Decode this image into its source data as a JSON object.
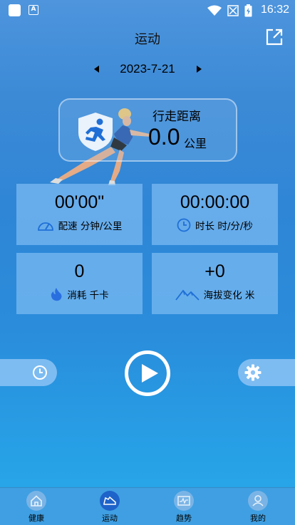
{
  "status_bar": {
    "time": "16:32"
  },
  "header": {
    "title": "运动"
  },
  "date_nav": {
    "date": "2023-7-21"
  },
  "distance": {
    "label": "行走距离",
    "value": "0.0",
    "unit": "公里"
  },
  "stats": [
    {
      "value": "00'00\"",
      "label": "配速 分钟/公里",
      "icon": "speedometer-icon"
    },
    {
      "value": "00:00:00",
      "label": "时长 时/分/秒",
      "icon": "clock-icon"
    },
    {
      "value": "0",
      "label": "消耗 千卡",
      "icon": "flame-icon"
    },
    {
      "value": "+0",
      "label": "海拔变化 米",
      "icon": "mountain-icon"
    }
  ],
  "tabs": [
    {
      "label": "健康",
      "icon": "home-icon"
    },
    {
      "label": "运动",
      "icon": "shoe-icon"
    },
    {
      "label": "趋势",
      "icon": "trend-icon"
    },
    {
      "label": "我的",
      "icon": "person-icon"
    }
  ],
  "colors": {
    "accent": "#1e63c9",
    "icon_blue": "#1f6fd6",
    "card_bg": "#82bef5",
    "tab_bg": "#3f9fe2"
  }
}
